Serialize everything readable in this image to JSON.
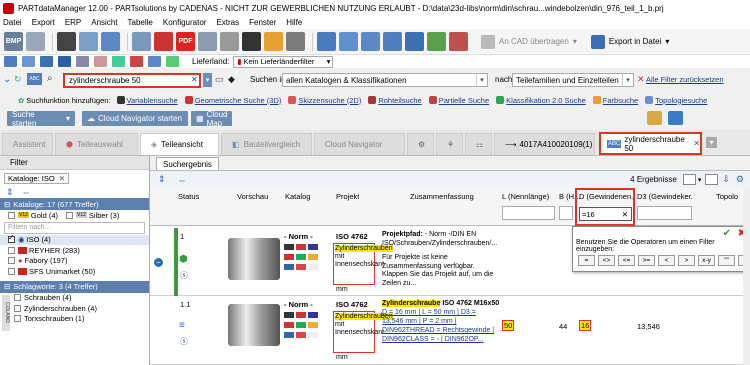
{
  "window": {
    "title": "PARTdataManager 12.00 - PARTsolutions by CADENAS - NICHT ZUR GEWERBLICHEN NUTZUNG ERLAUBT - D:\\data\\23d-libs\\norm\\din\\schrau...windebolzen\\din_976_teil_1_b.prj"
  },
  "menu": [
    "Datei",
    "Export",
    "ERP",
    "Ansicht",
    "Tabelle",
    "Konfigurator",
    "Extras",
    "Fenster",
    "Hilfe"
  ],
  "toolbar": {
    "cad_label": "An CAD übertragen",
    "export_label": "Export in Datei"
  },
  "row2": {
    "supplier_label": "Lieferland:",
    "supplier_value": "Kein Lieferländerfilter"
  },
  "search": {
    "value": "zylinderschraube 50",
    "in_label": "Suchen in",
    "scope": "allen Katalogen & Klassifikationen",
    "after_label": "nach",
    "after_value": "Teilefamilien und Einzelteilen",
    "reset_label": "Alle Filter zurücksetzen"
  },
  "functions": {
    "label": "Suchfunktion hinzufügen:",
    "items": [
      "Variablensuche",
      "Geometrische Suche (3D)",
      "Skizzensuche (2D)",
      "Rohteilsuche",
      "Partielle Suche",
      "Klassifikation 2.0 Suche",
      "Farbsuche",
      "Topologiesuche"
    ]
  },
  "actions": {
    "start": "Suche starten",
    "navigator": "Cloud Navigator starten",
    "map": "Cloud Map"
  },
  "tabs": [
    "Assistent",
    "Teileauswahl",
    "Teileansicht",
    "Bauteilvergleich",
    "Cloud Navigator",
    "4017A410020109(1)",
    "zylinderschraube 50"
  ],
  "left": {
    "header": "Filter",
    "catalog_label": "Kataloge:",
    "catalog_value": "ISO",
    "section1": "Kataloge: 17 (677 Treffer)",
    "gold": "Gold (4)",
    "silber": "Silber (3)",
    "filter_placeholder": "Filtern nach...",
    "iso": "ISO (4)",
    "reyher": "REYHER (283)",
    "fabory": "Fabory (197)",
    "sfs": "SFS Unimarket (50)",
    "section2": "Schlagworte: 3 (4 Treffer)",
    "kw1": "Schrauben (4)",
    "kw2": "Zylinderschrauben (4)",
    "kw3": "Torxschrauben (1)",
    "vertical": "COLAND"
  },
  "results": {
    "tab": "Suchergebnis",
    "count": "4 Ergebnisse",
    "columns": [
      "Status",
      "Vorschau",
      "Katalog",
      "Projekt",
      "Zusammenfassung",
      "L (Nennlänge)",
      "B (H...",
      "D (Gewindenen...",
      "D3 (Gewindeker...",
      "Topolo"
    ],
    "filter_value": "=16",
    "operator_hint": "Benutzen Sie die Operatoren um einen Filter einzugeben:",
    "operators": [
      "=",
      "<>",
      "<=",
      ">=",
      "<",
      ">",
      "x-y",
      "\"\"",
      "!"
    ],
    "row1": {
      "index": "1",
      "catalog": "- Norm -",
      "project": "ISO 4762",
      "name_hl": "Zylinderschrauben",
      "name_rest": "mit Innensechskant",
      "unit": "mm",
      "path_label": "Projektpfad:",
      "path": "- Norm -/DIN EN ISO/Schrauben/Zylinderschrauben/...",
      "path_hl": "Zylinderschrauben",
      "desc": "Für Projekte ist keine Zusammenfassung verfügbar. Klappen Sie das Projekt auf, um die Zeilen zu..."
    },
    "row2": {
      "index": "1.1",
      "catalog": "- Norm -",
      "project": "ISO 4762",
      "name_hl": "Zylinderschrauben",
      "name_rest": "mit Innensechskant",
      "unit": "mm",
      "title_hl": "Zylinderschraube",
      "title_rest": "ISO 4762 M16x50",
      "summary_line1": "D = 16 mm | L = 50 mm | D3 =",
      "summary_line2": "13,546 mm | P = 2 mm |",
      "summary_line3": "DIN962THREAD = Rechtsgewinde |",
      "summary_line4": "DIN962CLASS = - | DIN962OP...",
      "L": "50",
      "B": "44",
      "D": "16",
      "D3": "13,546"
    }
  }
}
